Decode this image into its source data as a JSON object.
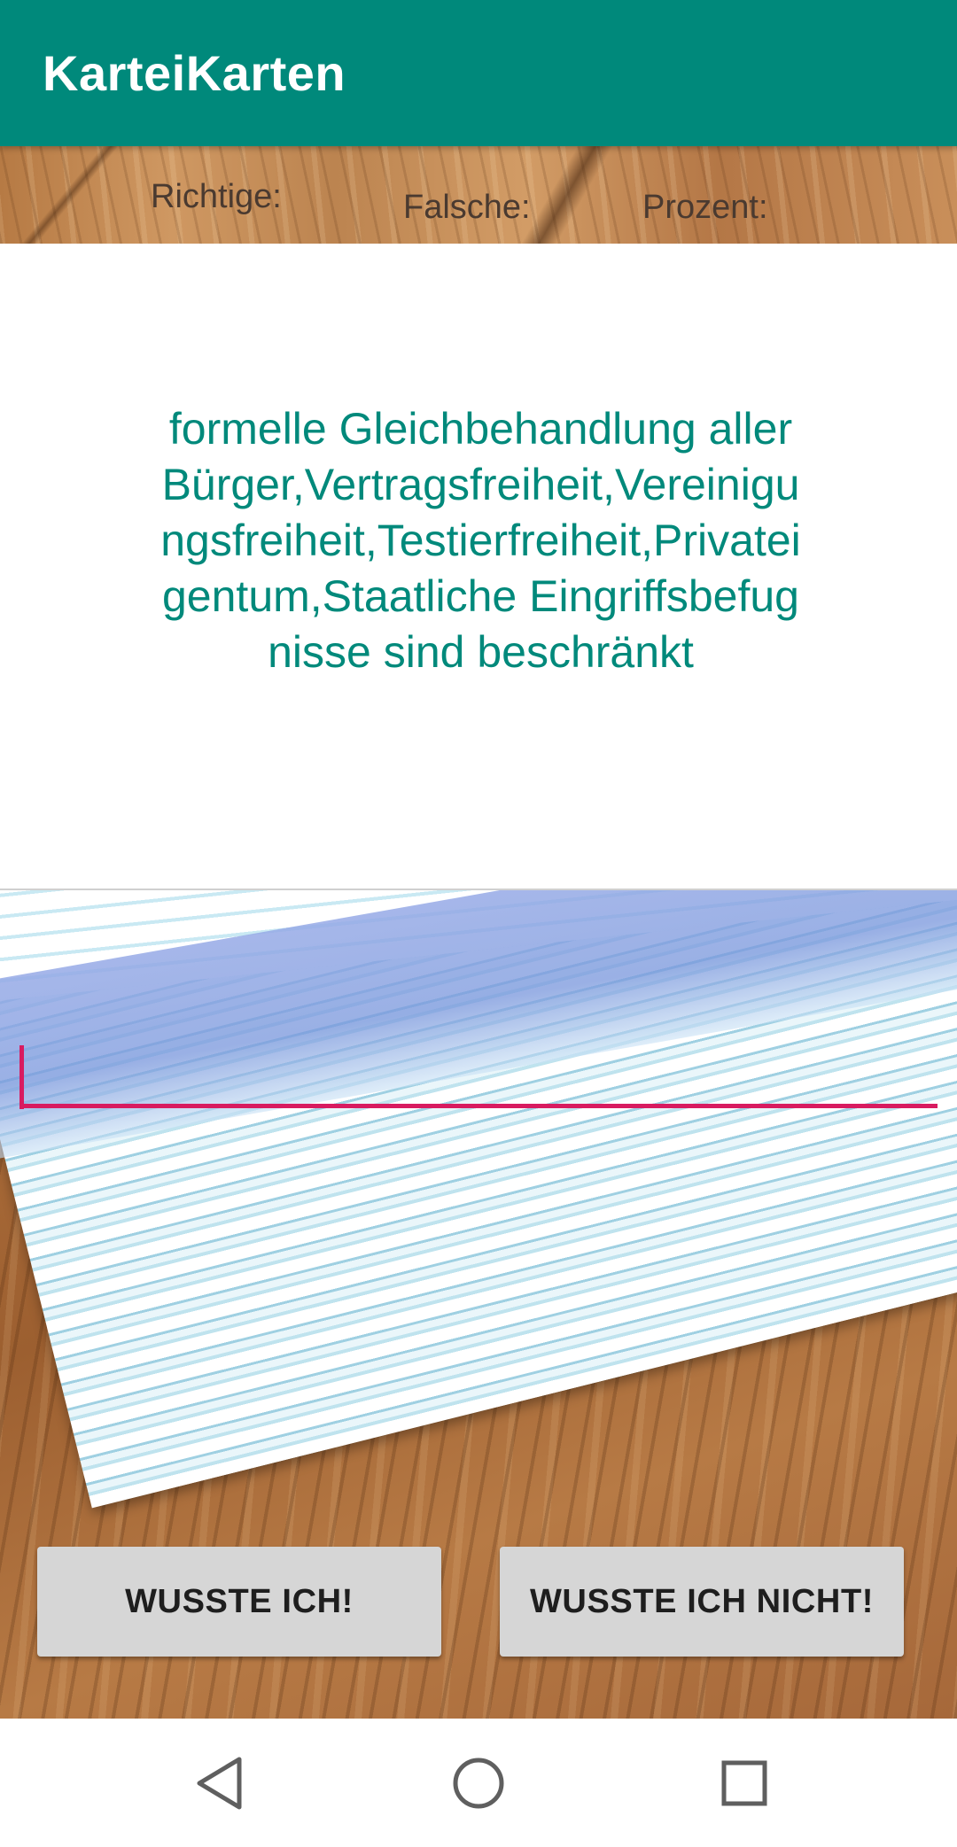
{
  "app": {
    "title": "KarteiKarten"
  },
  "stats": {
    "correct_label": "Richtige:",
    "wrong_label": "Falsche:",
    "percent_label": "Prozent:"
  },
  "card": {
    "question": "formelle Gleichbehandlung aller Bürger,Vertragsfreiheit,Vereinigungsfreiheit,Testierfreiheit,Privateigentum,Staatliche Eingriffsbefugnisse sind beschränkt"
  },
  "answer": {
    "value": "",
    "placeholder": ""
  },
  "buttons": {
    "knew": "WUSSTE ICH!",
    "did_not_know": "WUSSTE ICH NICHT!"
  },
  "navbar": {
    "back_icon": "back-triangle-icon",
    "home_icon": "home-circle-icon",
    "recent_icon": "recent-apps-square-icon"
  },
  "colors": {
    "primary": "#00897b",
    "accent": "#d81b60",
    "button_bg": "#d6d6d6"
  }
}
